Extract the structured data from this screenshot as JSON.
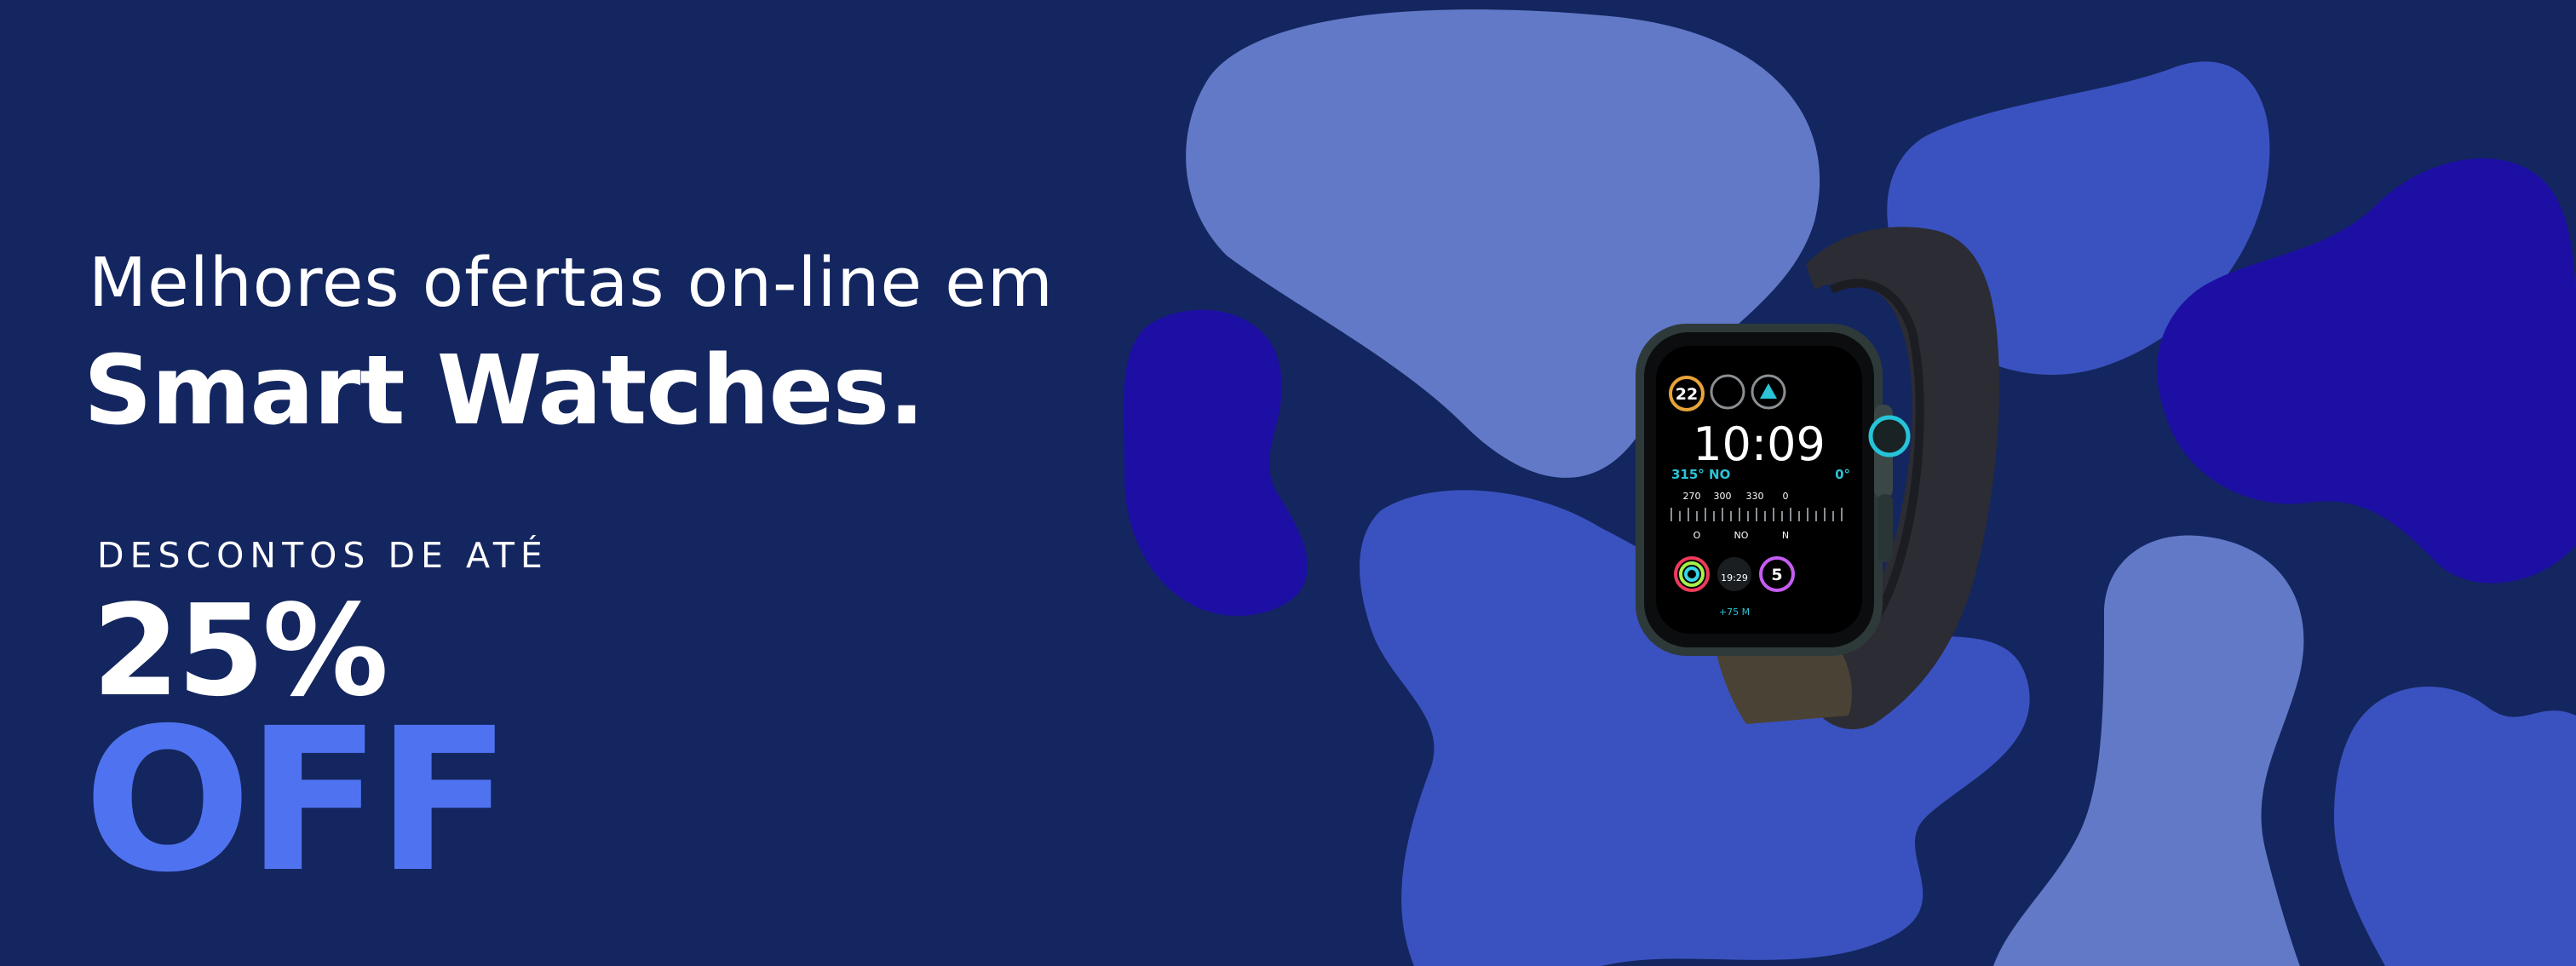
{
  "banner": {
    "headline_top": "Melhores ofertas on-line em",
    "headline_main": "Smart Watches.",
    "discount_label": "DESCONTOS DE ATÉ",
    "discount_value": "25%",
    "discount_off": "OFF"
  },
  "watch": {
    "time": "10:09",
    "heading": "315° NO",
    "heading_right": "0°",
    "compass_values": [
      "270",
      "300",
      "330",
      "0"
    ],
    "compass_letters": [
      "O",
      "NO",
      "N"
    ],
    "complication_left": "22",
    "complication_bottom_time": "19:29",
    "complication_right": "5",
    "altitude": "+75 M"
  },
  "colors": {
    "background": "#14265f",
    "accent": "#4f73f0",
    "blob_light": "#6279c8",
    "blob_mid": "#3a52c0",
    "blob_dark": "#1d0fa3"
  }
}
